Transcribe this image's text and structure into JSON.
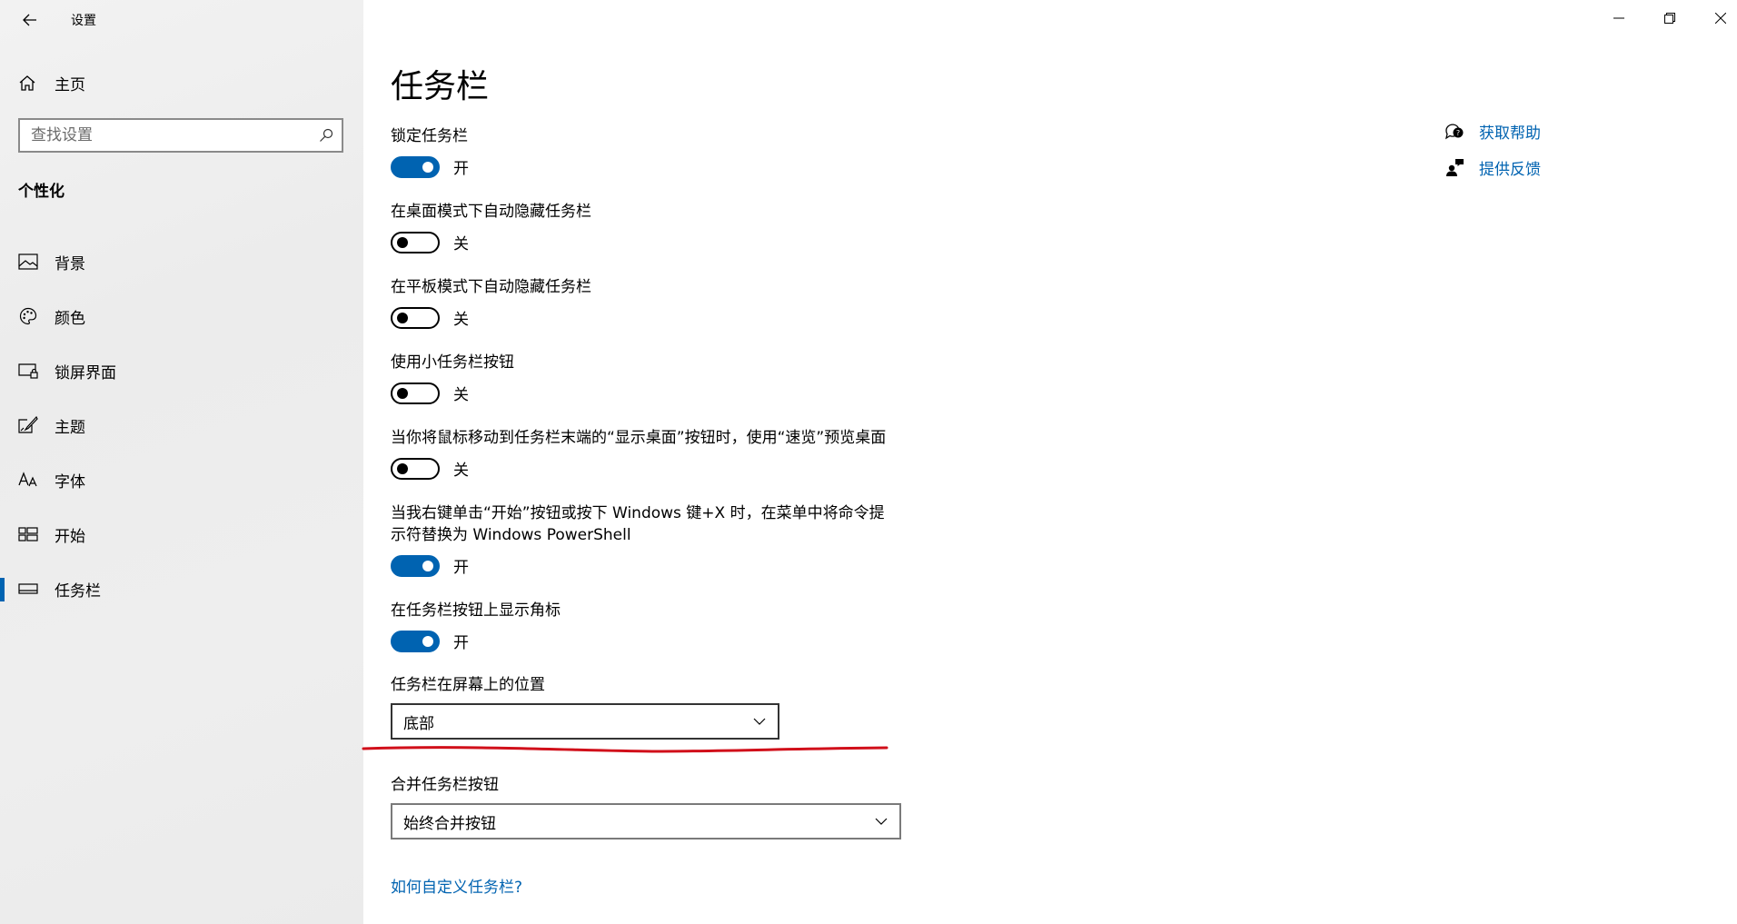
{
  "window": {
    "title": "设置",
    "controls": [
      "minimize",
      "maximize",
      "close"
    ]
  },
  "sidebar": {
    "home_label": "主页",
    "search_placeholder": "查找设置",
    "section_title": "个性化",
    "items": [
      {
        "label": "背景",
        "icon": "image-icon",
        "active": false
      },
      {
        "label": "颜色",
        "icon": "palette-icon",
        "active": false
      },
      {
        "label": "锁屏界面",
        "icon": "lock-screen-icon",
        "active": false
      },
      {
        "label": "主题",
        "icon": "theme-brush-icon",
        "active": false
      },
      {
        "label": "字体",
        "icon": "font-icon",
        "active": false
      },
      {
        "label": "开始",
        "icon": "start-menu-icon",
        "active": false
      },
      {
        "label": "任务栏",
        "icon": "taskbar-icon",
        "active": true
      }
    ]
  },
  "main": {
    "title": "任务栏",
    "settings": [
      {
        "label": "锁定任务栏",
        "state": "on",
        "state_text": "开"
      },
      {
        "label": "在桌面模式下自动隐藏任务栏",
        "state": "off",
        "state_text": "关"
      },
      {
        "label": "在平板模式下自动隐藏任务栏",
        "state": "off",
        "state_text": "关"
      },
      {
        "label": "使用小任务栏按钮",
        "state": "off",
        "state_text": "关"
      },
      {
        "label": "当你将鼠标移动到任务栏末端的“显示桌面”按钮时，使用“速览”预览桌面",
        "state": "off",
        "state_text": "关"
      },
      {
        "label_line1": "当我右键单击“开始”按钮或按下 Windows 键+X 时，在菜单中将命令提",
        "label_line2": "示符替换为 Windows PowerShell",
        "state": "on",
        "state_text": "开"
      },
      {
        "label": "在任务栏按钮上显示角标",
        "state": "on",
        "state_text": "开"
      }
    ],
    "position": {
      "label": "任务栏在屏幕上的位置",
      "value": "底部"
    },
    "combine": {
      "label": "合并任务栏按钮",
      "value": "始终合并按钮"
    },
    "help_link": "如何自定义任务栏?"
  },
  "aside": {
    "get_help": "获取帮助",
    "feedback": "提供反馈"
  },
  "colors": {
    "accent": "#0063b1",
    "annotation": "#d10f1a"
  }
}
